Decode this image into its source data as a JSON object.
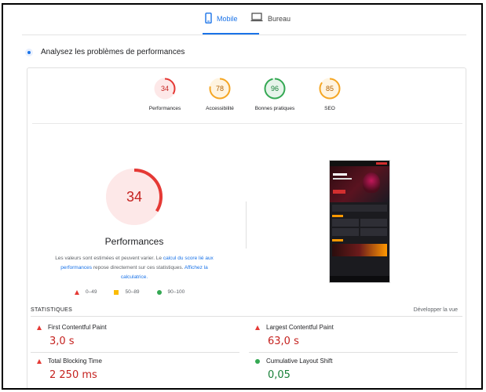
{
  "tabs": {
    "mobile": "Mobile",
    "desktop": "Bureau"
  },
  "section": {
    "title": "Analysez les problèmes de performances"
  },
  "scores": [
    {
      "value": 34,
      "label": "Performances",
      "status": "fail",
      "color": "#e53935"
    },
    {
      "value": 78,
      "label": "Accessibilité",
      "status": "average",
      "color": "#f5a623"
    },
    {
      "value": 96,
      "label": "Bonnes pratiques",
      "status": "pass",
      "color": "#34a853"
    },
    {
      "value": 85,
      "label": "SEO",
      "status": "average",
      "color": "#f5a623"
    }
  ],
  "main_score": {
    "value": 34,
    "label": "Performances",
    "color": "#e53935"
  },
  "description": {
    "part1": "Les valeurs sont estimées et peuvent varier. Le ",
    "link1": "calcul du score lié aux performances",
    "part2": " repose directement sur ces statistiques. ",
    "link2": "Affichez la calculatrice."
  },
  "legend": {
    "fail": "0–49",
    "average": "50–89",
    "pass": "90–100"
  },
  "stats": {
    "header": "STATISTIQUES",
    "expand": "Développer la vue",
    "fcp": {
      "label": "First Contentful Paint",
      "value": "3,0 s",
      "status": "fail"
    },
    "lcp": {
      "label": "Largest Contentful Paint",
      "value": "63,0 s",
      "status": "fail"
    },
    "tbt": {
      "label": "Total Blocking Time",
      "value": "2 250 ms",
      "status": "fail"
    },
    "cls": {
      "label": "Cumulative Layout Shift",
      "value": "0,05",
      "status": "pass"
    }
  }
}
